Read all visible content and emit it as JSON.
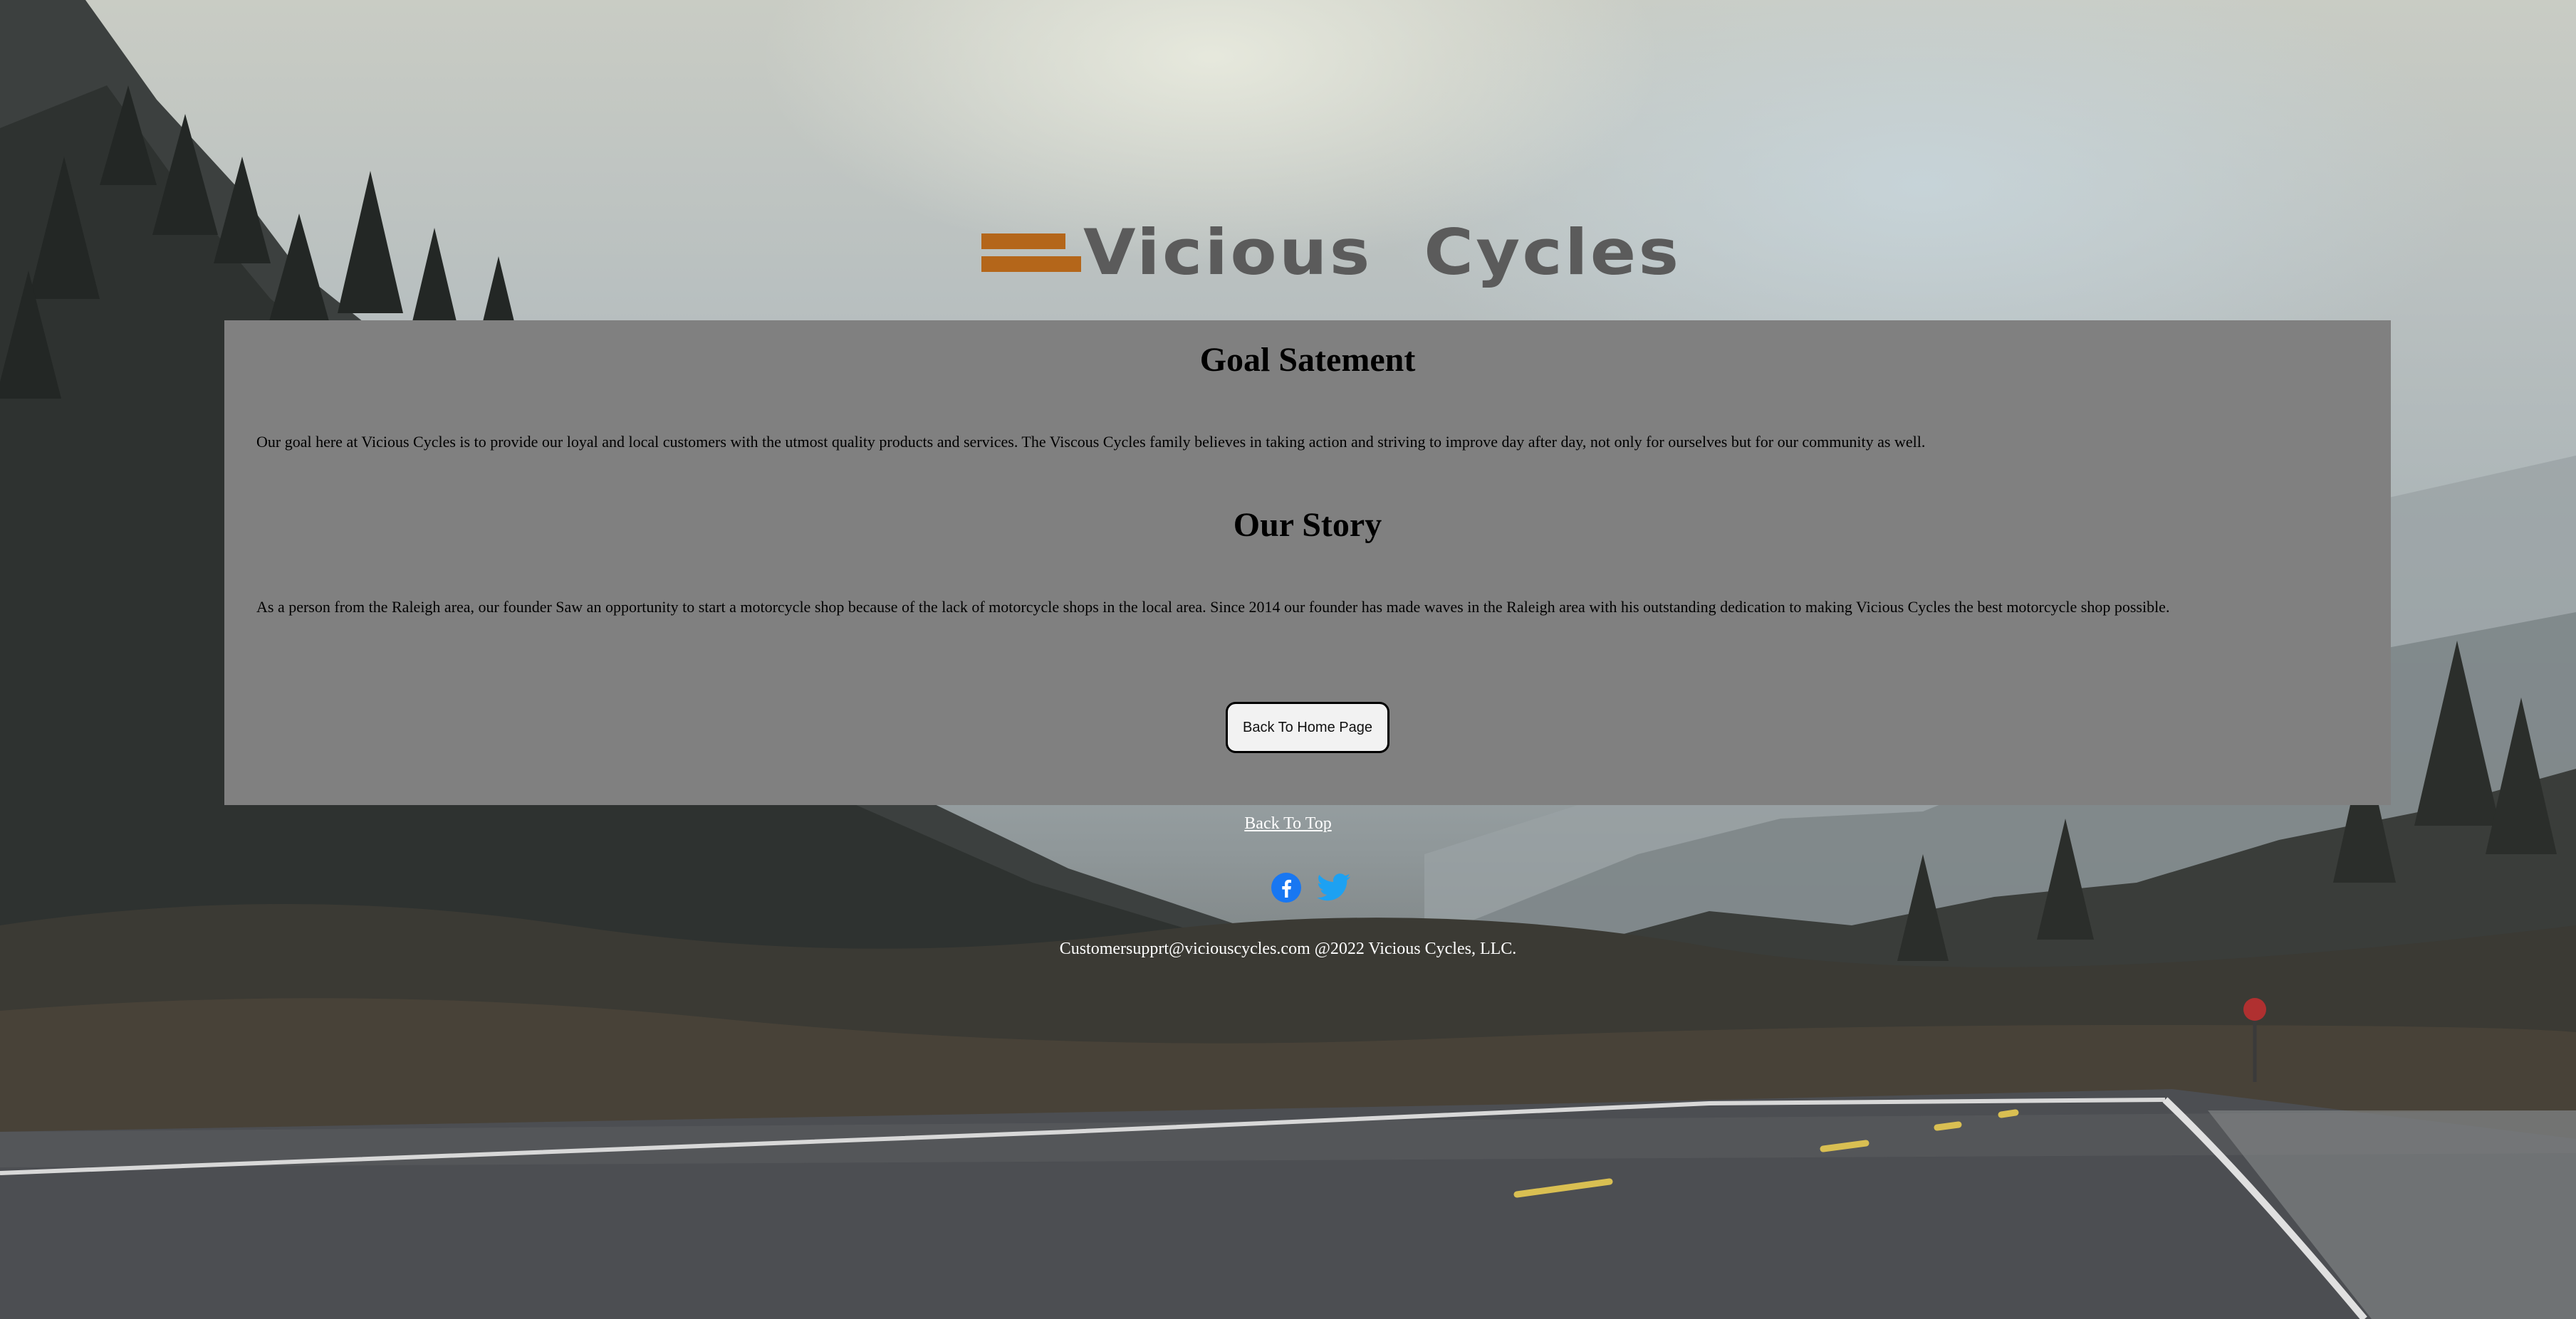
{
  "logo": {
    "text": "Vicious  Cycles",
    "accent_color": "#b4661a",
    "text_color": "#5b5b5b"
  },
  "panel": {
    "background": "#808080",
    "goal": {
      "title": "Goal Satement",
      "text": "Our goal here at Vicious Cycles is to provide our loyal and local customers with the utmost quality products and services. The Viscous Cycles family believes in taking action and striving to improve day after day, not only for ourselves but for our community as well."
    },
    "story": {
      "title": "Our Story",
      "text": "As a person from the Raleigh area, our founder Saw an opportunity to start a motorcycle shop because of the lack of motorcycle shops in the local area. Since 2014 our founder has made waves in the Raleigh area with his outstanding dedication to making Vicious Cycles the best motorcycle shop possible."
    },
    "home_button_label": "Back To Home Page"
  },
  "footer": {
    "back_to_top": "Back To Top",
    "social": [
      {
        "name": "facebook-icon",
        "color": "#1877f2"
      },
      {
        "name": "twitter-icon",
        "color": "#1da1f2"
      }
    ],
    "copyright": "Customersupprt@viciouscycles.com @2022 Vicious Cycles, LLC."
  }
}
